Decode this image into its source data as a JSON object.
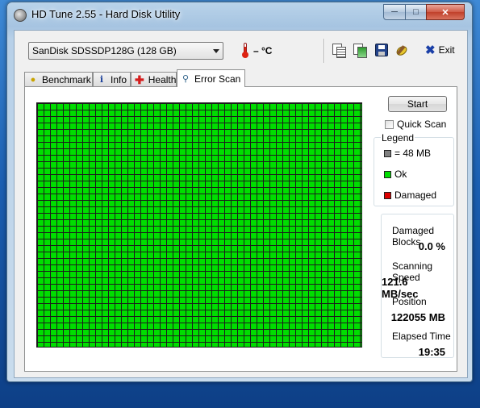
{
  "window": {
    "title": "HD Tune 2.55 - Hard Disk Utility"
  },
  "toolbar": {
    "drive_selected": "SanDisk SDSSDP128G (128 GB)",
    "temperature": "– °C",
    "exit_label": "Exit",
    "icons": [
      "thermometer-icon",
      "copy-icon",
      "copy-all-icon",
      "save-icon",
      "options-icon",
      "exit-icon"
    ]
  },
  "tabs": [
    {
      "label": "Benchmark",
      "icon": "lightbulb-icon"
    },
    {
      "label": "Info",
      "icon": "info-icon"
    },
    {
      "label": "Health",
      "icon": "health-cross-icon"
    },
    {
      "label": "Error Scan",
      "icon": "magnifier-icon",
      "active": true
    }
  ],
  "error_scan": {
    "start_label": "Start",
    "quick_scan_label": "Quick Scan",
    "quick_scan_checked": false,
    "legend": {
      "title": "Legend",
      "items": [
        {
          "label": "= 48 MB",
          "color": "#808080"
        },
        {
          "label": "Ok",
          "color": "#00dd00"
        },
        {
          "label": "Damaged",
          "color": "#dd0000"
        }
      ]
    },
    "stats": {
      "damaged_blocks_label": "Damaged Blocks",
      "damaged_blocks_value": "0.0 %",
      "scanning_speed_label": "Scanning Speed",
      "scanning_speed_value": "121.6 MB/sec",
      "position_label": "Position",
      "position_value": "122055 MB",
      "elapsed_time_label": "Elapsed Time",
      "elapsed_time_value": "19:35"
    },
    "block_map_state": "all-ok",
    "block_color_ok": "#00dd00"
  }
}
